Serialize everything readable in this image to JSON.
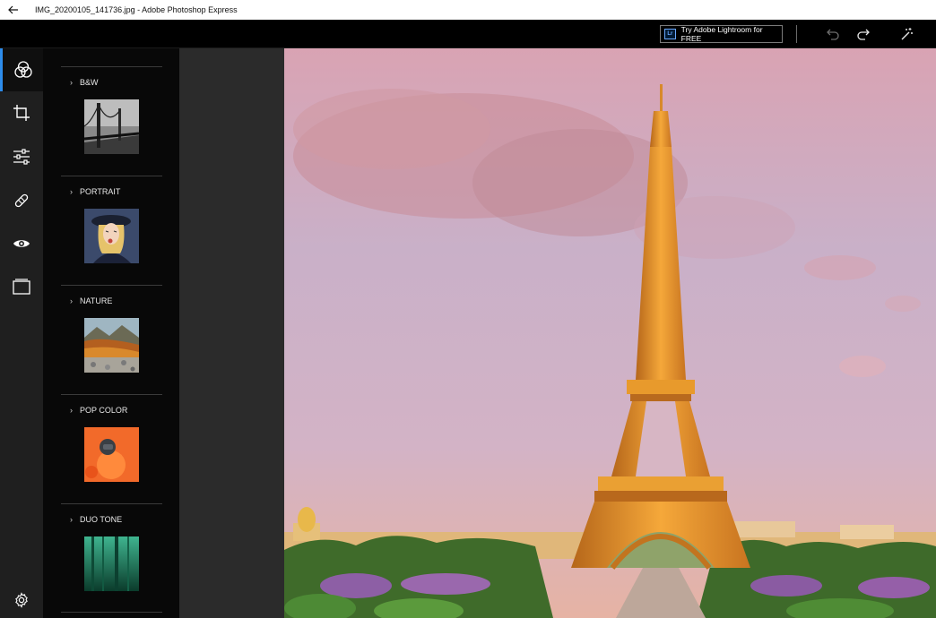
{
  "window": {
    "title": "IMG_20200105_141736.jpg - Adobe Photoshop Express",
    "back_icon": "arrow-left-icon"
  },
  "toolbar": {
    "lightroom_badge": "Lr",
    "lightroom_label": "Try Adobe Lightroom for FREE",
    "icons": [
      "undo-icon",
      "redo-icon",
      "auto-fix-icon"
    ]
  },
  "rail": {
    "items": [
      {
        "name": "looks-icon",
        "active": true
      },
      {
        "name": "crop-icon",
        "active": false
      },
      {
        "name": "adjustments-icon",
        "active": false
      },
      {
        "name": "healing-icon",
        "active": false
      },
      {
        "name": "red-eye-icon",
        "active": false
      },
      {
        "name": "borders-icon",
        "active": false
      }
    ],
    "settings_icon": "settings-icon"
  },
  "filters": {
    "sections": [
      {
        "label": "B&W"
      },
      {
        "label": "PORTRAIT"
      },
      {
        "label": "NATURE"
      },
      {
        "label": "POP COLOR"
      },
      {
        "label": "DUO TONE"
      }
    ]
  },
  "colors": {
    "accent": "#2d8ceb",
    "rail_bg": "#1f1f1f",
    "panel_bg": "#080808",
    "gap_bg": "#2b2b2b",
    "tower": "#e89a2c"
  }
}
